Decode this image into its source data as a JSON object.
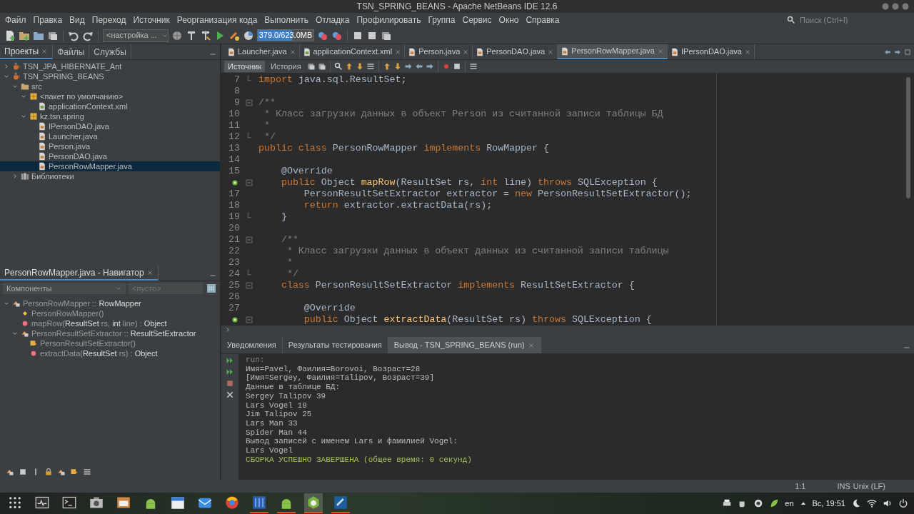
{
  "window": {
    "title": "TSN_SPRING_BEANS - Apache NetBeans IDE 12.6"
  },
  "menu": [
    "Файл",
    "Правка",
    "Вид",
    "Переход",
    "Источник",
    "Реорганизация кода",
    "Выполнить",
    "Отладка",
    "Профилировать",
    "Группа",
    "Сервис",
    "Окно",
    "Справка"
  ],
  "search": {
    "placeholder": "Поиск (Ctrl+I)"
  },
  "toolbar": {
    "config_select": "<настройка ...",
    "memory": {
      "label": "379.0/623.0MB",
      "level": 0.61
    }
  },
  "projects": {
    "tabs": [
      {
        "label": "Проекты",
        "selected": true
      },
      {
        "label": "Файлы",
        "selected": false
      },
      {
        "label": "Службы",
        "selected": false
      }
    ],
    "tree": [
      {
        "kind": "project",
        "label": "TSN_JPA_HIBERNATE_Ant",
        "expanded": false,
        "selected": false
      },
      {
        "kind": "project",
        "label": "TSN_SPRING_BEANS",
        "expanded": true,
        "selected": false,
        "children": [
          {
            "kind": "folder",
            "label": "src",
            "expanded": true,
            "selected": false,
            "children": [
              {
                "kind": "package",
                "label": "<пакет по умолчанию>",
                "expanded": true,
                "selected": false,
                "children": [
                  {
                    "kind": "xml",
                    "label": "applicationContext.xml",
                    "selected": false
                  }
                ]
              },
              {
                "kind": "package",
                "label": "kz.tsn.spring",
                "expanded": true,
                "selected": false,
                "children": [
                  {
                    "kind": "java",
                    "label": "IPersonDAO.java",
                    "selected": false
                  },
                  {
                    "kind": "java",
                    "label": "Launcher.java",
                    "selected": false
                  },
                  {
                    "kind": "java",
                    "label": "Person.java",
                    "selected": false
                  },
                  {
                    "kind": "java",
                    "label": "PersonDAO.java",
                    "selected": false
                  },
                  {
                    "kind": "java",
                    "label": "PersonRowMapper.java",
                    "selected": true
                  }
                ]
              }
            ]
          },
          {
            "kind": "library",
            "label": "Библиотеки",
            "expanded": false,
            "selected": false
          }
        ]
      }
    ]
  },
  "navigator": {
    "title": "PersonRowMapper.java - Навигатор",
    "filter": "Компоненты",
    "filter2_placeholder": "<пусто>",
    "tree": [
      {
        "kind": "class",
        "label": "PersonRowMapper :: **RowMapper**",
        "expanded": true,
        "children": [
          {
            "kind": "constructor",
            "label": "PersonRowMapper()"
          },
          {
            "kind": "method",
            "label": "mapRow(**ResultSet** rs, **int** line) : **Object**"
          },
          {
            "kind": "class",
            "label": "PersonResultSetExtractor :: **ResultSetExtractor**",
            "expanded": true,
            "children": [
              {
                "kind": "inner_constructor",
                "label": "PersonResultSetExtractor()"
              },
              {
                "kind": "method",
                "label": "extractData(**ResultSet** rs) : **Object**"
              }
            ]
          }
        ]
      }
    ]
  },
  "editor": {
    "tabs": [
      {
        "label": "Launcher.java",
        "kind": "java",
        "selected": false
      },
      {
        "label": "applicationContext.xml",
        "kind": "xml",
        "selected": false
      },
      {
        "label": "Person.java",
        "kind": "java",
        "selected": false
      },
      {
        "label": "PersonDAO.java",
        "kind": "java",
        "selected": false
      },
      {
        "label": "PersonRowMapper.java",
        "kind": "java",
        "selected": true
      },
      {
        "label": "IPersonDAO.java",
        "kind": "java",
        "selected": false
      }
    ],
    "views": [
      {
        "label": "Источник",
        "selected": true
      },
      {
        "label": "История",
        "selected": false
      }
    ],
    "lines": [
      {
        "number": "7",
        "fold_end": true,
        "code": [
          {
            "text": "import",
            "kind": "keyword"
          },
          {
            "text": " java.sql.ResultSet;",
            "kind": "plain"
          }
        ]
      },
      {
        "number": "8"
      },
      {
        "number": "9",
        "fold_start": true,
        "code": [
          {
            "text": "/**",
            "kind": "comment"
          }
        ]
      },
      {
        "number": "10",
        "code": [
          {
            "text": " * Класс загрузки данных в объект Person из считанной записи таблицы БД",
            "kind": "comment"
          }
        ]
      },
      {
        "number": "11",
        "code": [
          {
            "text": " *",
            "kind": "comment"
          }
        ]
      },
      {
        "number": "12",
        "fold_end": true,
        "code": [
          {
            "text": " */",
            "kind": "comment"
          }
        ]
      },
      {
        "number": "13",
        "code": [
          {
            "text": "public class",
            "kind": "keyword"
          },
          {
            "text": " PersonRowMapper ",
            "kind": "plain"
          },
          {
            "text": "implements",
            "kind": "keyword"
          },
          {
            "text": " RowMapper {",
            "kind": "plain"
          }
        ]
      },
      {
        "number": "14"
      },
      {
        "number": "15",
        "code": [
          {
            "text": "    @Override",
            "kind": "plain"
          }
        ]
      },
      {
        "override": true,
        "fold_start": true,
        "code": [
          {
            "text": "    public",
            "kind": "keyword"
          },
          {
            "text": " Object ",
            "kind": "plain"
          },
          {
            "text": "mapRow",
            "kind": "method"
          },
          {
            "text": "(ResultSet rs, ",
            "kind": "plain"
          },
          {
            "text": "int",
            "kind": "keyword"
          },
          {
            "text": " line) ",
            "kind": "plain"
          },
          {
            "text": "throws",
            "kind": "keyword"
          },
          {
            "text": " SQLException {",
            "kind": "plain"
          }
        ]
      },
      {
        "number": "17",
        "code": [
          {
            "text": "        PersonResultSetExtractor extractor = ",
            "kind": "plain"
          },
          {
            "text": "new",
            "kind": "keyword"
          },
          {
            "text": " PersonResultSetExtractor();",
            "kind": "plain"
          }
        ]
      },
      {
        "number": "18",
        "code": [
          {
            "text": "        return",
            "kind": "keyword"
          },
          {
            "text": " extractor.extractData(rs);",
            "kind": "plain"
          }
        ]
      },
      {
        "number": "19",
        "fold_end": true,
        "code": [
          {
            "text": "    }",
            "kind": "plain"
          }
        ]
      },
      {
        "number": "20"
      },
      {
        "number": "21",
        "fold_start": true,
        "code": [
          {
            "text": "    /**",
            "kind": "comment"
          }
        ]
      },
      {
        "number": "22",
        "code": [
          {
            "text": "     * Класс загрузки данных в объект данных из считанной записи таблицы",
            "kind": "comment"
          }
        ]
      },
      {
        "number": "23",
        "code": [
          {
            "text": "     *",
            "kind": "comment"
          }
        ]
      },
      {
        "number": "24",
        "fold_end": true,
        "code": [
          {
            "text": "     */",
            "kind": "comment"
          }
        ]
      },
      {
        "number": "25",
        "fold_start": true,
        "code": [
          {
            "text": "    class",
            "kind": "keyword"
          },
          {
            "text": " PersonResultSetExtractor ",
            "kind": "plain"
          },
          {
            "text": "implements",
            "kind": "keyword"
          },
          {
            "text": " ResultSetExtractor {",
            "kind": "plain"
          }
        ]
      },
      {
        "number": "26"
      },
      {
        "number": "27",
        "code": [
          {
            "text": "        @Override",
            "kind": "plain"
          }
        ]
      },
      {
        "override": true,
        "fold_start": true,
        "code": [
          {
            "text": "        public",
            "kind": "keyword"
          },
          {
            "text": " Object ",
            "kind": "plain"
          },
          {
            "text": "extractData",
            "kind": "method"
          },
          {
            "text": "(ResultSet rs) ",
            "kind": "plain"
          },
          {
            "text": "throws",
            "kind": "keyword"
          },
          {
            "text": " SQLException {",
            "kind": "plain"
          }
        ]
      }
    ]
  },
  "output": {
    "tabs": [
      {
        "label": "Уведомления",
        "selected": false
      },
      {
        "label": "Результаты тестирования",
        "selected": false
      },
      {
        "label": "Вывод - TSN_SPRING_BEANS (run)",
        "selected": true
      }
    ],
    "lines": [
      {
        "text": "run:",
        "kind": "info"
      },
      {
        "text": "Имя=Pavel, Фаилия=Borovoi, Возраст=28",
        "kind": "plain"
      },
      {
        "text": "[Имя=Sergey, Фаилия=Talipov, Возраст=39]",
        "kind": "plain"
      },
      {
        "text": "Данные в таблице БД:",
        "kind": "plain"
      },
      {
        "text": "Sergey Talipov 39",
        "kind": "plain"
      },
      {
        "text": "Lars Vogel 18",
        "kind": "plain"
      },
      {
        "text": "Jim Talipov 25",
        "kind": "plain"
      },
      {
        "text": "Lars Man 33",
        "kind": "plain"
      },
      {
        "text": "Spider Man 44",
        "kind": "plain"
      },
      {
        "text": "Вывод записей с именем Lars и фамилией Vogel:",
        "kind": "plain"
      },
      {
        "text": "Lars Vogel",
        "kind": "plain"
      },
      {
        "text": "СБОРКА УСПЕШНО ЗАВЕРШЕНА (общее время: 0 секунд)",
        "kind": "success"
      }
    ]
  },
  "status_bar": {
    "position": "1:1",
    "mode": "INS",
    "line_endings": "Unix (LF)"
  },
  "taskbar": {
    "apps": [
      {
        "kind": "launcher",
        "running": false,
        "selected": false
      },
      {
        "kind": "monitor",
        "running": false,
        "selected": false
      },
      {
        "kind": "terminal",
        "running": false,
        "selected": false
      },
      {
        "kind": "camera",
        "running": false,
        "selected": false
      },
      {
        "kind": "archive",
        "running": false,
        "selected": false
      },
      {
        "kind": "android",
        "running": false,
        "selected": false
      },
      {
        "kind": "calendar",
        "running": false,
        "selected": false
      },
      {
        "kind": "mail",
        "running": false,
        "selected": false
      },
      {
        "kind": "browser",
        "running": false,
        "selected": false
      },
      {
        "kind": "film",
        "running": true,
        "selected": false
      },
      {
        "kind": "android",
        "running": true,
        "selected": false
      },
      {
        "kind": "cube",
        "running": true,
        "selected": true
      },
      {
        "kind": "editor",
        "running": true,
        "selected": false
      }
    ],
    "keyboard_layout": "en",
    "clock": "Вс, 19:51"
  }
}
